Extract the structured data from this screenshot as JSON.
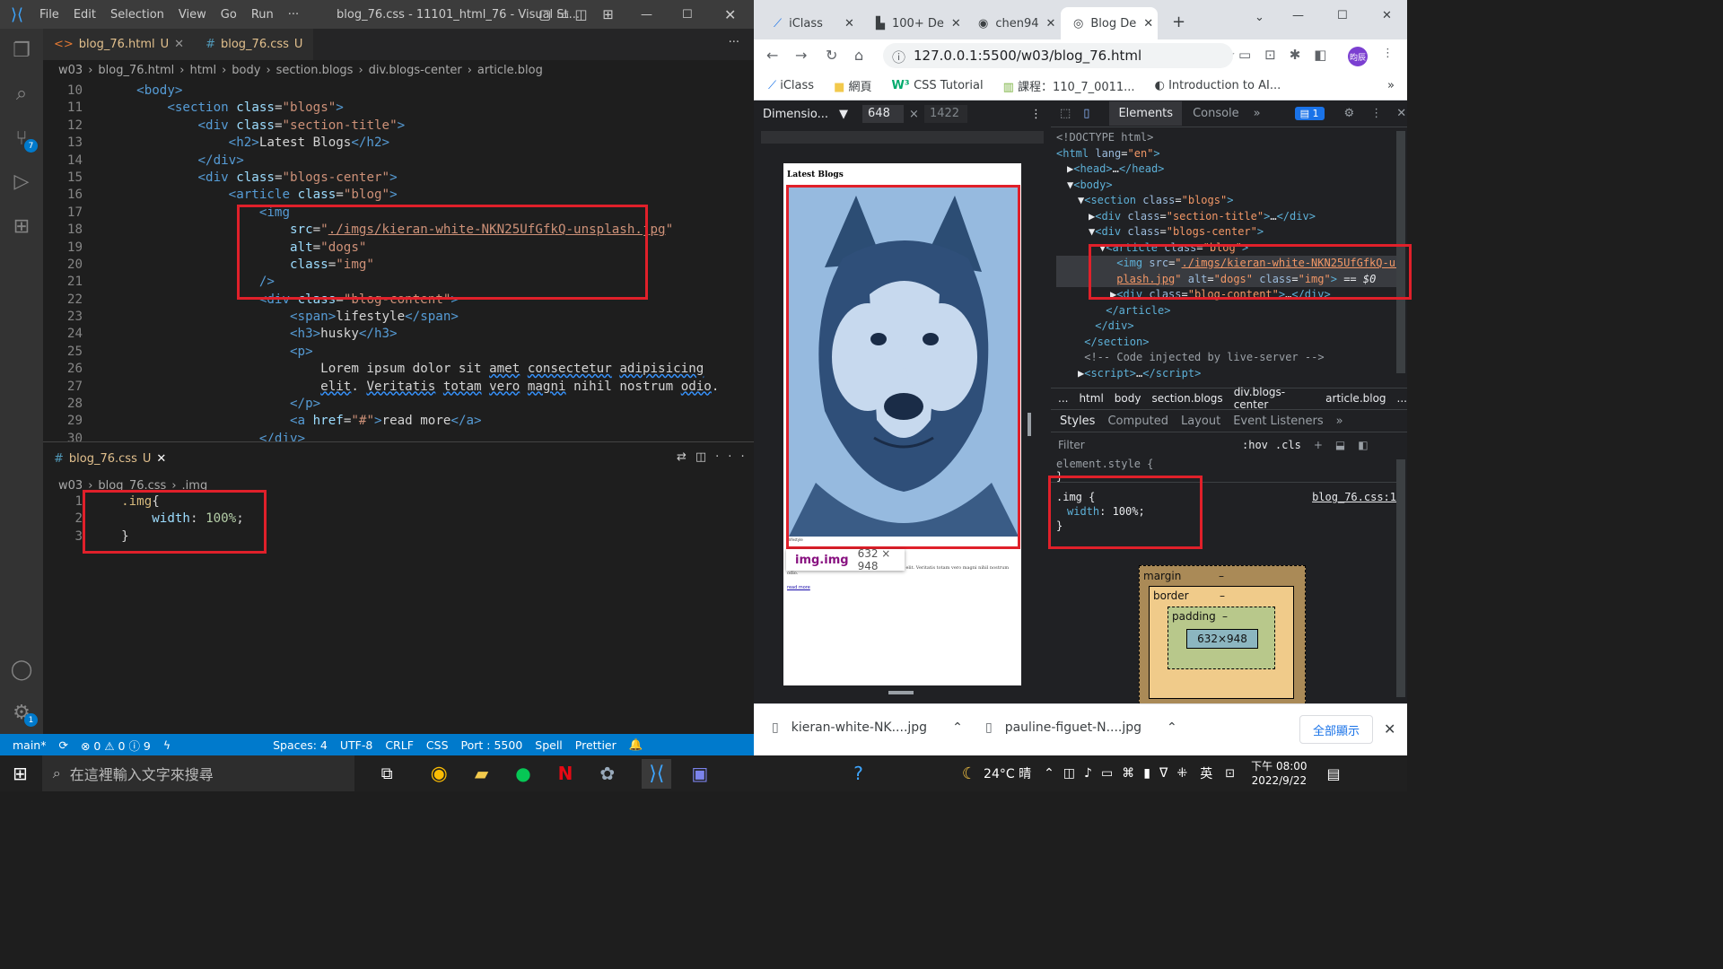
{
  "vscode": {
    "menu": [
      "File",
      "Edit",
      "Selection",
      "View",
      "Go",
      "Run",
      "···"
    ],
    "title": "blog_76.css - 11101_html_76 - Visual St...",
    "scm_badge": "7",
    "settings_badge": "1",
    "tabs": [
      {
        "label": "blog_76.html",
        "status": "U",
        "icon": "<>"
      },
      {
        "label": "blog_76.css",
        "status": "U",
        "icon": "#"
      }
    ],
    "breadcrumb1": [
      "w03",
      "blog_76.html",
      "html",
      "body",
      "section.blogs",
      "div.blogs-center",
      "article.blog"
    ],
    "html_lines": [
      {
        "n": "10",
        "html": "    <span class=t>&lt;body&gt;</span>"
      },
      {
        "n": "11",
        "html": "        <span class=t>&lt;section</span> <span class=at>class</span>=<span class=s>\"blogs\"</span><span class=t>&gt;</span>"
      },
      {
        "n": "12",
        "html": "            <span class=t>&lt;div</span> <span class=at>class</span>=<span class=s>\"section-title\"</span><span class=t>&gt;</span>"
      },
      {
        "n": "13",
        "html": "                <span class=t>&lt;h2&gt;</span><span class=tx>Latest Blogs</span><span class=t>&lt;/h2&gt;</span>"
      },
      {
        "n": "14",
        "html": "            <span class=t>&lt;/div&gt;</span>"
      },
      {
        "n": "15",
        "html": "            <span class=t>&lt;div</span> <span class=at>class</span>=<span class=s>\"blogs-center\"</span><span class=t>&gt;</span>"
      },
      {
        "n": "16",
        "html": "                <span class=t>&lt;article</span> <span class=at>class</span>=<span class=s>\"blog\"</span><span class=t>&gt;</span>"
      },
      {
        "n": "17",
        "html": "                    <span class=t>&lt;img</span>"
      },
      {
        "n": "18",
        "html": "                        <span class=at>src</span>=<span class=s>\"<u>./imgs/kieran-white-NKN25UfGfkQ-unsplash.jpg</u>\"</span>"
      },
      {
        "n": "19",
        "html": "                        <span class=at>alt</span>=<span class=s>\"dogs\"</span>"
      },
      {
        "n": "20",
        "html": "                        <span class=at>class</span>=<span class=s>\"img\"</span>"
      },
      {
        "n": "21",
        "html": "                    <span class=t>/&gt;</span>"
      },
      {
        "n": "22",
        "html": "                    <span class=t>&lt;div</span> <span class=at>class</span>=<span class=s>\"blog-content\"</span><span class=t>&gt;</span>"
      },
      {
        "n": "23",
        "html": "                        <span class=t>&lt;span&gt;</span><span class=tx>lifestyle</span><span class=t>&lt;/span&gt;</span>"
      },
      {
        "n": "24",
        "html": "                        <span class=t>&lt;h3&gt;</span><span class=tx>husky</span><span class=t>&lt;/h3&gt;</span>"
      },
      {
        "n": "25",
        "html": "                        <span class=t>&lt;p&gt;</span>"
      },
      {
        "n": "26",
        "html": "                            <span class=tx>Lorem ipsum dolor sit <span class=sq>amet</span> <span class=sq>consectetur</span> <span class=sq>adipisicing</span></span>"
      },
      {
        "n": "27",
        "html": "                            <span class=tx><span class=sq>elit</span>. <span class=sq>Veritatis</span> <span class=sq>totam</span> <span class=sq>vero</span> <span class=sq>magni</span> nihil nostrum <span class=sq>odio</span>.</span>"
      },
      {
        "n": "28",
        "html": "                        <span class=t>&lt;/p&gt;</span>"
      },
      {
        "n": "29",
        "html": "                        <span class=t>&lt;a</span> <span class=at>href</span>=<span class=s>\"#\"</span><span class=t>&gt;</span><span class=tx>read more</span><span class=t>&lt;/a&gt;</span>"
      },
      {
        "n": "30",
        "html": "                    <span class=t>&lt;/div&gt;</span>"
      }
    ],
    "panel_tab": {
      "label": "blog_76.css",
      "status": "U"
    },
    "breadcrumb2": [
      "w03",
      "blog_76.css",
      ".img"
    ],
    "css_lines": [
      {
        "n": "1",
        "html": "  <span style='color:#d7ba7d'>.img</span><span class=tx>{</span>"
      },
      {
        "n": "2",
        "html": "      <span class=at>width</span><span class=tx>: </span><span style='color:#b5cea8'>100%</span><span class=tx>;</span>"
      },
      {
        "n": "3",
        "html": "  <span class=tx>}</span>"
      }
    ],
    "status": {
      "branch": "main*",
      "problems": "⊗ 0 ⚠ 0 ⓘ 9",
      "spaces": "Spaces: 4",
      "encoding": "UTF-8",
      "eol": "CRLF",
      "language": "CSS",
      "port": "Port : 5500",
      "spell": "Spell",
      "prettier": "Prettier"
    }
  },
  "chrome": {
    "tabs": [
      "iClass",
      "100+ De",
      "chen94",
      "Blog De"
    ],
    "url": "127.0.0.1:5500/w03/blog_76.html",
    "profile": "昀辰",
    "bookmarks": [
      "iClass",
      "網頁",
      "CSS Tutorial",
      "課程：110_7_0011...",
      "Introduction to AI..."
    ],
    "device": {
      "label": "Dimensio...",
      "width": "648",
      "height": "1422"
    },
    "page": {
      "heading": "Latest Blogs",
      "tooltip_name": "img.img",
      "tooltip_size": "632 × 948",
      "text": "Lorem ipsum dolor sit amet consectetur adipisicing elit. Veritatis totam vero magni nihil nostrum odio.",
      "link": "read more",
      "label": "lifestyle"
    },
    "devtools": {
      "tabs": [
        "Elements",
        "Console"
      ],
      "issues": "1",
      "dom": [
        {
          "indent": 0,
          "html": "<span class=cm>&lt;!DOCTYPE html&gt;</span>"
        },
        {
          "indent": 0,
          "html": "<span class=tg>&lt;html</span> <span class=an>lang</span>=<span class=av>\"en\"</span><span class=tg>&gt;</span>"
        },
        {
          "indent": 1,
          "html": "▶<span class=tg>&lt;head&gt;</span>…<span class=tg>&lt;/head&gt;</span>"
        },
        {
          "indent": 1,
          "html": "▼<span class=tg>&lt;body&gt;</span>"
        },
        {
          "indent": 2,
          "html": "▼<span class=tg>&lt;section</span> <span class=an>class</span>=<span class=av>\"blogs\"</span><span class=tg>&gt;</span>"
        },
        {
          "indent": 3,
          "html": "▶<span class=tg>&lt;div</span> <span class=an>class</span>=<span class=av>\"section-title\"</span><span class=tg>&gt;</span>…<span class=tg>&lt;/div&gt;</span>"
        },
        {
          "indent": 3,
          "html": "▼<span class=tg>&lt;div</span> <span class=an>class</span>=<span class=av>\"blogs-center\"</span><span class=tg>&gt;</span>"
        },
        {
          "indent": 4,
          "html": "▼<span class=tg>&lt;article</span> <span class=an>class</span>=<span class=av>\"blog\"</span><span class=tg>&gt;</span>"
        },
        {
          "indent": 5,
          "html": " <span class=tg>&lt;img</span> <span class=an>src</span>=<span class=av>\"<u>./imgs/kieran-white-NKN25UfGfkQ-uns</u></span>",
          "sel": true
        },
        {
          "indent": 5,
          "html": " <span class=av><u>plash.jpg</u>\"</span> <span class=an>alt</span>=<span class=av>\"dogs\"</span> <span class=an>class</span>=<span class=av>\"img\"</span><span class=tg>&gt;</span> == <i>$0</i>",
          "sel": true
        },
        {
          "indent": 5,
          "html": "▶<span class=tg>&lt;div</span> <span class=an>class</span>=<span class=av>\"blog-content\"</span><span class=tg>&gt;</span>…<span class=tg>&lt;/div&gt;</span>"
        },
        {
          "indent": 4,
          "html": " <span class=tg>&lt;/article&gt;</span>"
        },
        {
          "indent": 3,
          "html": " <span class=tg>&lt;/div&gt;</span>"
        },
        {
          "indent": 2,
          "html": " <span class=tg>&lt;/section&gt;</span>"
        },
        {
          "indent": 2,
          "html": " <span class=cm>&lt;!-- Code injected by live-server --&gt;</span>"
        },
        {
          "indent": 2,
          "html": "▶<span class=tg>&lt;script&gt;</span>…<span class=tg>&lt;/script&gt;</span>"
        }
      ],
      "crumbs": [
        "...",
        "html",
        "body",
        "section.blogs",
        "div.blogs-center",
        "article.blog",
        "..."
      ],
      "style_tabs": [
        "Styles",
        "Computed",
        "Layout",
        "Event Listeners",
        "»"
      ],
      "filter": "Filter",
      "hov": ":hov",
      "cls": ".cls",
      "element_style": "element.style {",
      "close_brace": "}",
      "rule_selector": ".img {",
      "rule_prop": "width",
      "rule_val": "100%;",
      "rule_source": "blog_76.css:1",
      "box": {
        "margin": "margin",
        "border": "border",
        "padding": "padding",
        "content": "632×948",
        "dash": "–"
      }
    },
    "downloads": [
      {
        "name": "kieran-white-NK....jpg"
      },
      {
        "name": "pauline-figuet-N....jpg"
      }
    ],
    "show_all": "全部顯示"
  },
  "taskbar": {
    "search": "在這裡輸入文字來搜尋",
    "weather": "24°C 晴",
    "lang": "英",
    "time": "下午 08:00",
    "date": "2022/9/22"
  },
  "colors": {
    "accent": "#007acc",
    "highlight": "#e0202a",
    "overlay": "#6fa8dc"
  }
}
